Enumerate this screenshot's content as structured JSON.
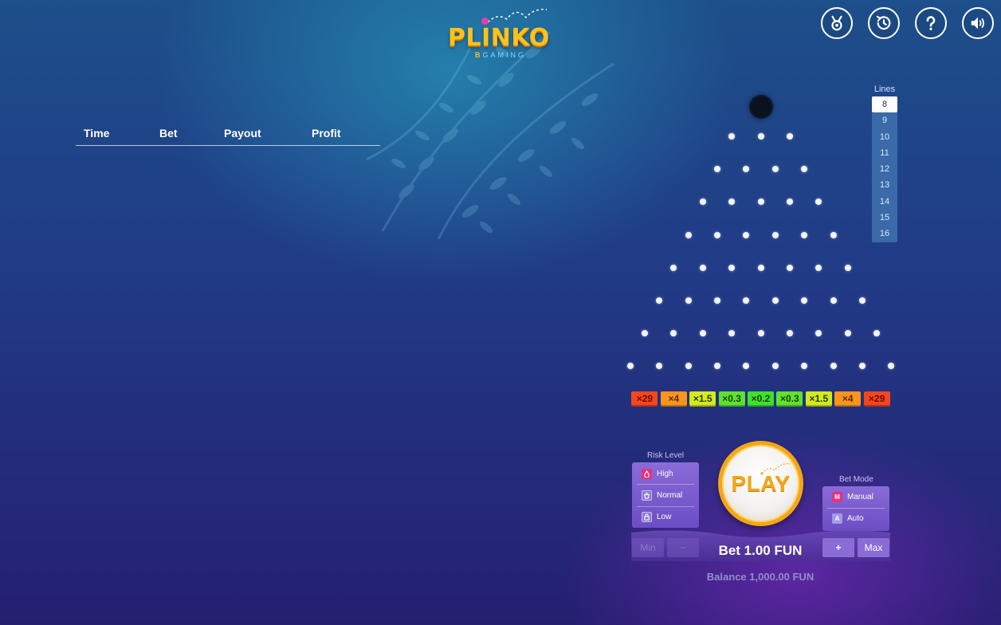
{
  "logo": {
    "title": "PLINKO",
    "subtitle_b": "B",
    "subtitle": "GAMING"
  },
  "top_buttons": [
    {
      "name": "achievements-button",
      "icon": "medal-icon"
    },
    {
      "name": "history-button",
      "icon": "history-icon"
    },
    {
      "name": "help-button",
      "icon": "question-icon"
    },
    {
      "name": "sound-button",
      "icon": "speaker-icon"
    }
  ],
  "history": {
    "columns": [
      "Time",
      "Bet",
      "Payout",
      "Profit"
    ],
    "rows": []
  },
  "board": {
    "rows": 8,
    "multipliers": [
      "×29",
      "×4",
      "×1.5",
      "×0.3",
      "×0.2",
      "×0.3",
      "×1.5",
      "×4",
      "×29"
    ],
    "multiplier_colors": [
      "#f3461f",
      "#f8951d",
      "#d4ea1b",
      "#5ee22d",
      "#3ee22d",
      "#5ee22d",
      "#d4ea1b",
      "#f8951d",
      "#f3461f"
    ]
  },
  "lines": {
    "title": "Lines",
    "options": [
      "8",
      "9",
      "10",
      "11",
      "12",
      "13",
      "14",
      "15",
      "16"
    ],
    "selected": "8"
  },
  "risk": {
    "title": "Risk Level",
    "options": [
      "High",
      "Normal",
      "Low"
    ],
    "selected": "High"
  },
  "bet_mode": {
    "title": "Bet Mode",
    "options": [
      {
        "key": "M",
        "label": "Manual"
      },
      {
        "key": "A",
        "label": "Auto"
      }
    ],
    "selected": "Manual"
  },
  "play": {
    "label": "PLAY"
  },
  "bet": {
    "min_label": "Min",
    "minus_label": "−",
    "plus_label": "+",
    "max_label": "Max",
    "text": "Bet 1.00 FUN"
  },
  "balance": {
    "text": "Balance 1,000.00 FUN"
  }
}
